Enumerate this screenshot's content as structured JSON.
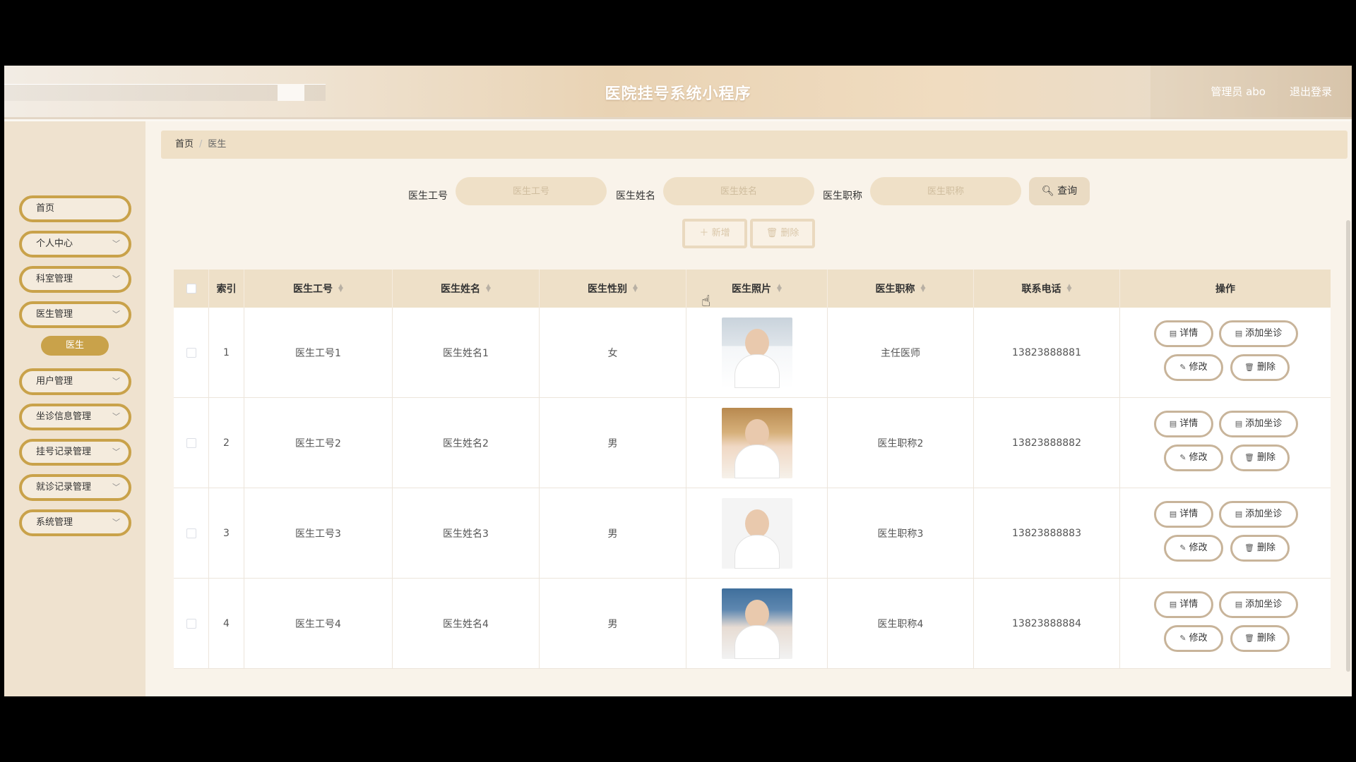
{
  "header": {
    "title": "医院挂号系统小程序",
    "user": "管理员 abo",
    "logout": "退出登录"
  },
  "sidebar": {
    "items": [
      {
        "label": "首页",
        "has_children": false
      },
      {
        "label": "个人中心",
        "has_children": true
      },
      {
        "label": "科室管理",
        "has_children": true
      },
      {
        "label": "医生管理",
        "has_children": true
      },
      {
        "label": "用户管理",
        "has_children": true
      },
      {
        "label": "坐诊信息管理",
        "has_children": true
      },
      {
        "label": "挂号记录管理",
        "has_children": true
      },
      {
        "label": "就诊记录管理",
        "has_children": true
      },
      {
        "label": "系统管理",
        "has_children": true
      }
    ],
    "active_sub": "医生"
  },
  "breadcrumb": {
    "home": "首页",
    "current": "医生"
  },
  "search": {
    "fields": [
      {
        "label": "医生工号",
        "placeholder": "医生工号"
      },
      {
        "label": "医生姓名",
        "placeholder": "医生姓名"
      },
      {
        "label": "医生职称",
        "placeholder": "医生职称"
      }
    ],
    "query_label": "查询"
  },
  "toolbar": {
    "add_label": "新增",
    "delete_label": "删除"
  },
  "table": {
    "columns": [
      "索引",
      "医生工号",
      "医生姓名",
      "医生性别",
      "医生照片",
      "医生职称",
      "联系电话",
      "操作"
    ],
    "rows": [
      {
        "index": "1",
        "id": "医生工号1",
        "name": "医生姓名1",
        "gender": "女",
        "title": "主任医师",
        "phone": "13823888881"
      },
      {
        "index": "2",
        "id": "医生工号2",
        "name": "医生姓名2",
        "gender": "男",
        "title": "医生职称2",
        "phone": "13823888882"
      },
      {
        "index": "3",
        "id": "医生工号3",
        "name": "医生姓名3",
        "gender": "男",
        "title": "医生职称3",
        "phone": "13823888883"
      },
      {
        "index": "4",
        "id": "医生工号4",
        "name": "医生姓名4",
        "gender": "男",
        "title": "医生职称4",
        "phone": "13823888884"
      }
    ],
    "actions": {
      "detail": "详情",
      "add_schedule": "添加坐诊",
      "edit": "修改",
      "delete": "删除"
    }
  },
  "colors": {
    "accent": "#c9a24a",
    "header_bg": "#eee0c8",
    "border_btn": "#c8b49a"
  }
}
